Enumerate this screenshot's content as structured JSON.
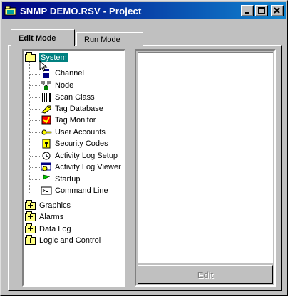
{
  "window": {
    "title": "SNMP DEMO.RSV - Project"
  },
  "tabs": [
    {
      "label": "Edit Mode"
    },
    {
      "label": "Run Mode"
    }
  ],
  "tree": {
    "root": "System",
    "children": [
      "Channel",
      "Node",
      "Scan Class",
      "Tag Database",
      "Tag Monitor",
      "User Accounts",
      "Security Codes",
      "Activity Log Setup",
      "Activity Log Viewer",
      "Startup",
      "Command Line"
    ],
    "folders": [
      "Graphics",
      "Alarms",
      "Data Log",
      "Logic and Control"
    ]
  },
  "edit_button": {
    "label": "Edit"
  },
  "colors": {
    "title_start": "#000080",
    "title_end": "#1084d0",
    "face": "#c0c0c0",
    "selection": "#008080"
  }
}
